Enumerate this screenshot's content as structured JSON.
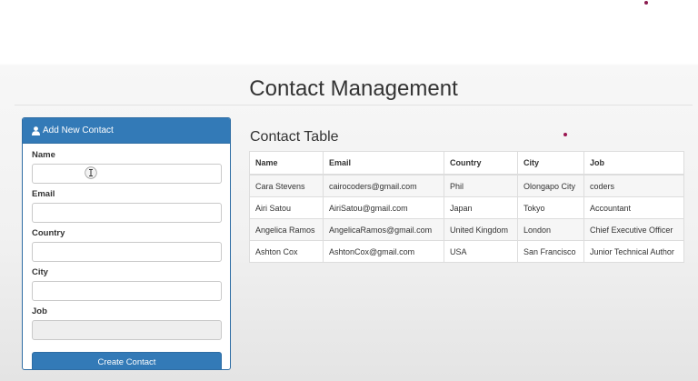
{
  "header": {
    "title": "Contact Management"
  },
  "form": {
    "heading": "Add New Contact",
    "icon": "user-icon",
    "fields": {
      "name": {
        "label": "Name",
        "value": ""
      },
      "email": {
        "label": "Email",
        "value": ""
      },
      "country": {
        "label": "Country",
        "value": ""
      },
      "city": {
        "label": "City",
        "value": ""
      },
      "job": {
        "label": "Job",
        "value": ""
      }
    },
    "submit_label": "Create Contact"
  },
  "table": {
    "title": "Contact Table",
    "columns": [
      "Name",
      "Email",
      "Country",
      "City",
      "Job"
    ],
    "rows": [
      [
        "Cara Stevens",
        "cairocoders@gmail.com",
        "Phil",
        "Olongapo City",
        "coders"
      ],
      [
        "Airi Satou",
        "AiriSatou@gmail.com",
        "Japan",
        "Tokyo",
        "Accountant"
      ],
      [
        "Angelica Ramos",
        "AngelicaRamos@gmail.com",
        "United Kingdom",
        "London",
        "Chief Executive Officer"
      ],
      [
        "Ashton Cox",
        "AshtonCox@gmail.com",
        "USA",
        "San Francisco",
        "Junior Technical Author"
      ]
    ]
  },
  "colors": {
    "primary": "#337ab7",
    "primary_border": "#2e6da4",
    "stripe": "#f6f6f6",
    "dot": "#9a1650"
  }
}
